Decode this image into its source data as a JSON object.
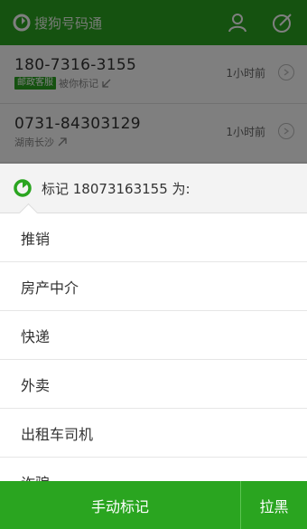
{
  "app": {
    "title": "搜狗号码通"
  },
  "calls": [
    {
      "number": "180-7316-3155",
      "tag": "邮政客服",
      "note": "被你标记",
      "time": "1小时前"
    },
    {
      "number": "0731-84303129",
      "location": "湖南长沙",
      "time": "1小时前"
    }
  ],
  "sheet": {
    "title": "标记 18073163155 为:",
    "options": [
      "推销",
      "房产中介",
      "快递",
      "外卖",
      "出租车司机",
      "诈骗"
    ]
  },
  "actions": {
    "manual": "手动标记",
    "block": "拉黑"
  },
  "colors": {
    "brand_green": "#2aa520"
  }
}
